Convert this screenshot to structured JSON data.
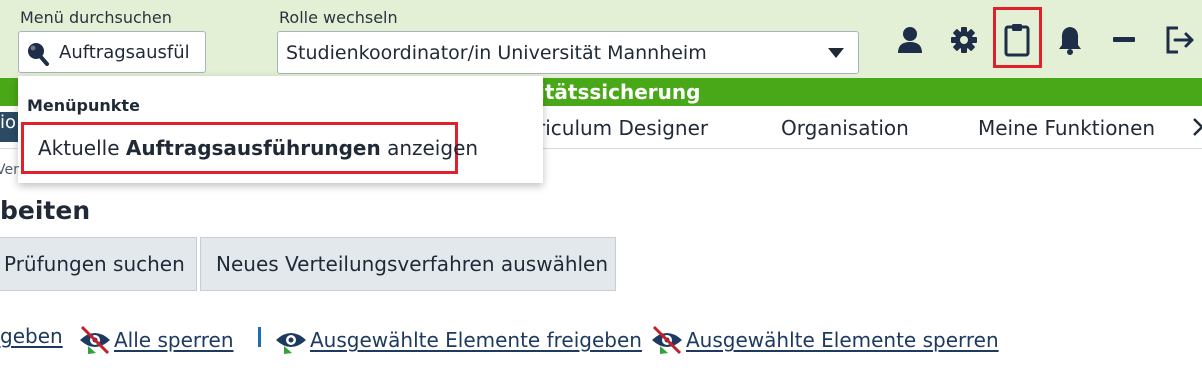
{
  "header": {
    "search_label": "Menü durchsuchen",
    "search_value": "Auftragsausfül",
    "role_label": "Rolle wechseln",
    "role_value": "Studienkoordinator/in Universität Mannheim",
    "icons": [
      "user-icon",
      "gear-icon",
      "clipboard-icon",
      "bell-icon",
      "minimize-icon",
      "logout-icon"
    ]
  },
  "green_bar": {
    "title": "itätssicherung"
  },
  "nav": {
    "left_fragment": "io",
    "items": [
      "riculum Designer",
      "Organisation",
      "Meine Funktionen"
    ]
  },
  "dropdown": {
    "heading": "Menüpunkte",
    "item_prefix": "Aktuelle ",
    "item_bold": "Auftragsausführungen",
    "item_suffix": " anzeigen"
  },
  "breadcrumb": "Ver",
  "page_title": "beiten",
  "buttons": {
    "search_exams": "Prüfungen suchen",
    "new_distribution": "Neues Verteilungsverfahren auswählen"
  },
  "actions": {
    "release_all": "geben",
    "lock_all": "Alle sperren",
    "release_selected": "Ausgewählte Elemente freigeben",
    "lock_selected": "Ausgewählte Elemente sperren"
  },
  "colors": {
    "header_bg": "#e3f0d5",
    "green_bar": "#49a817",
    "highlight": "#e0202a",
    "icon": "#1e2d48"
  }
}
